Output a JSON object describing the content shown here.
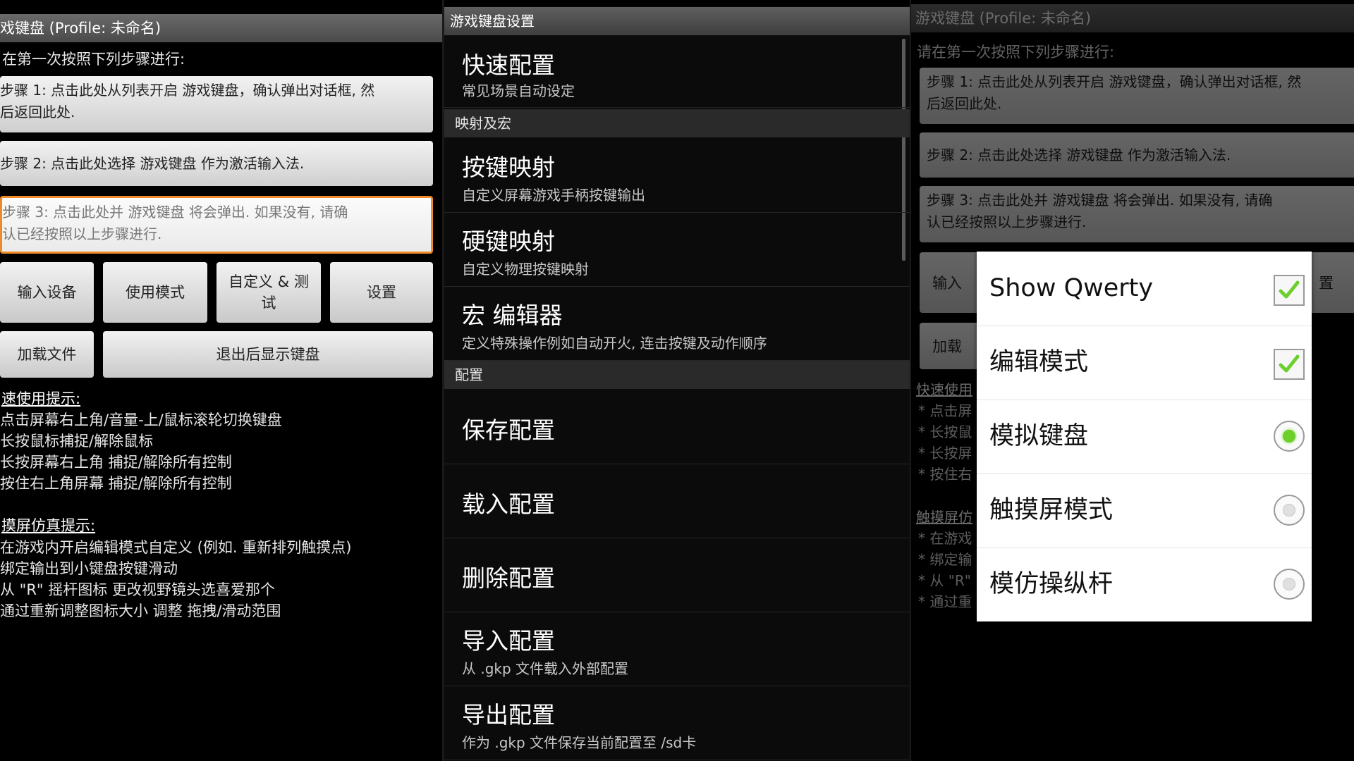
{
  "left": {
    "title": "戏键盘 (Profile: 未命名)",
    "instruction": "在第一次按照下列步骤进行:",
    "steps": [
      {
        "line1": "步骤 1: 点击此处从列表开启 游戏键盘，确认弹出对话框, 然",
        "line2": "后返回此处."
      },
      {
        "line1": "步骤 2: 点击此处选择 游戏键盘 作为激活输入法.",
        "line2": ""
      },
      {
        "line1": "步骤 3: 点击此处并 游戏键盘 将会弹出. 如果没有, 请确",
        "line2": "认已经按照以上步骤进行."
      }
    ],
    "buttons": {
      "input_device": "输入设备",
      "use_mode": "使用模式",
      "custom_test_1": "自定义 & 测",
      "custom_test_2": "试",
      "settings": "设置",
      "load_file": "加载文件",
      "show_keyboard_exit": "退出后显示键盘"
    },
    "quick_tips_heading": "速使用提示:",
    "quick_tips": [
      "点击屏幕右上角/音量-上/鼠标滚轮切换键盘",
      "长按鼠标捕捉/解除鼠标",
      "长按屏幕右上角 捕捉/解除所有控制",
      "按住右上角屏幕 捕捉/解除所有控制"
    ],
    "touch_tips_heading": "摸屏仿真提示:",
    "touch_tips": [
      "在游戏内开启编辑模式自定义 (例如. 重新排列触摸点)",
      "绑定输出到小键盘按键滑动",
      "从 \"R\" 摇杆图标 更改视野镜头选喜爱那个",
      "通过重新调整图标大小 调整 拖拽/滑动范围"
    ]
  },
  "middle": {
    "title": "游戏键盘设置",
    "items": [
      {
        "title": "快速配置",
        "subtitle": "常见场景自动设定"
      },
      {
        "section": "映射及宏"
      },
      {
        "title": "按键映射",
        "subtitle": "自定义屏幕游戏手柄按键输出"
      },
      {
        "title": "硬键映射",
        "subtitle": "自定义物理按键映射"
      },
      {
        "title": "宏 编辑器",
        "subtitle": "定义特殊操作例如自动开火, 连击按键及动作顺序"
      },
      {
        "section": "配置"
      },
      {
        "title": "保存配置",
        "subtitle": ""
      },
      {
        "title": "载入配置",
        "subtitle": ""
      },
      {
        "title": "删除配置",
        "subtitle": ""
      },
      {
        "title": "导入配置",
        "subtitle": "从 .gkp 文件载入外部配置"
      },
      {
        "title": "导出配置",
        "subtitle": "作为 .gkp 文件保存当前配置至 /sd卡"
      }
    ]
  },
  "right": {
    "title": "游戏键盘 (Profile: 未命名)",
    "instruction": "请在第一次按照下列步骤进行:",
    "steps": [
      {
        "line1": "步骤 1: 点击此处从列表开启 游戏键盘，确认弹出对话框, 然",
        "line2": "后返回此处."
      },
      {
        "line1": "步骤 2: 点击此处选择 游戏键盘 作为激活输入法.",
        "line2": ""
      },
      {
        "line1": "步骤 3: 点击此处并 游戏键盘 将会弹出. 如果没有, 请确",
        "line2": "认已经按照以上步骤进行."
      }
    ],
    "btn_input_partial": "输入",
    "btn_settings_partial": "置",
    "btn_load_partial": "加载",
    "quick_tips_heading_partial": "快速使用",
    "quick_tips_partial": [
      "* 点击屏",
      "* 长按鼠",
      "* 长按屏",
      "* 按住右"
    ],
    "touch_tips_heading_partial": "触摸屏仿",
    "touch_tips_partial": [
      "* 在游戏",
      "* 绑定输",
      "* 从 \"R\"",
      "* 通过重"
    ],
    "dialog": {
      "options": [
        {
          "label": "Show Qwerty",
          "control": "checkbox",
          "checked": true
        },
        {
          "label": "编辑模式",
          "control": "checkbox",
          "checked": true
        },
        {
          "label": "模拟键盘",
          "control": "radio",
          "selected": true
        },
        {
          "label": "触摸屏模式",
          "control": "radio",
          "selected": false
        },
        {
          "label": "模仿操纵杆",
          "control": "radio",
          "selected": false
        }
      ],
      "accent_color": "#6ccf2c"
    }
  }
}
